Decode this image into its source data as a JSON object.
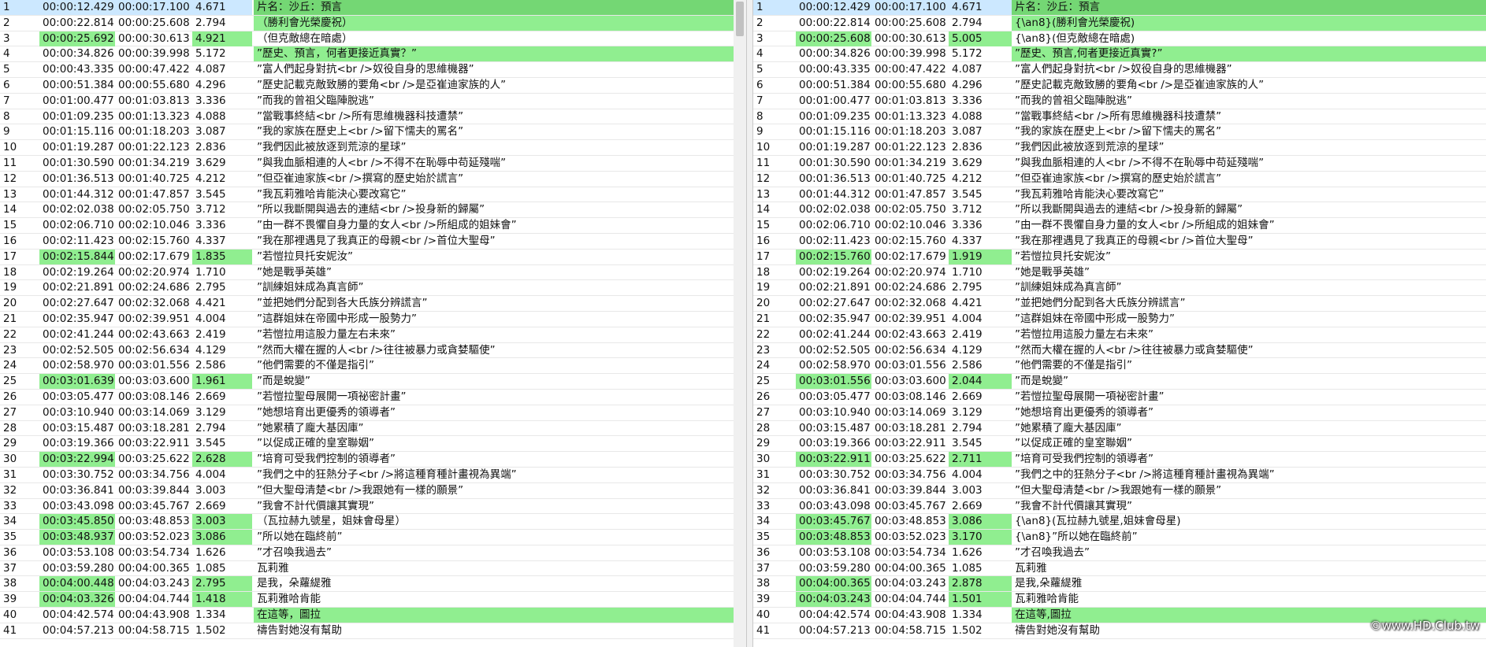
{
  "left": {
    "rows": [
      {
        "n": "1",
        "s": "00:00:12.429",
        "e": "00:00:17.100",
        "d": "4.671",
        "t": "片名：沙丘：預言"
      },
      {
        "n": "2",
        "s": "00:00:22.814",
        "e": "00:00:25.608",
        "d": "2.794",
        "t": "（勝利會光榮慶祝）"
      },
      {
        "n": "3",
        "s": "00:00:25.692",
        "e": "00:00:30.613",
        "d": "4.921",
        "t": "（但克敵總在暗處）"
      },
      {
        "n": "4",
        "s": "00:00:34.826",
        "e": "00:00:39.998",
        "d": "5.172",
        "t": "”歷史、預言，何者更接近真實？”"
      },
      {
        "n": "5",
        "s": "00:00:43.335",
        "e": "00:00:47.422",
        "d": "4.087",
        "t": "”富人們起身對抗<br />奴役自身的思維機器”"
      },
      {
        "n": "6",
        "s": "00:00:51.384",
        "e": "00:00:55.680",
        "d": "4.296",
        "t": "”歷史記載克敵致勝的要角<br />是亞崔迪家族的人”"
      },
      {
        "n": "7",
        "s": "00:01:00.477",
        "e": "00:01:03.813",
        "d": "3.336",
        "t": "”而我的曾祖父臨陣脫逃”"
      },
      {
        "n": "8",
        "s": "00:01:09.235",
        "e": "00:01:13.323",
        "d": "4.088",
        "t": "”當戰事終結<br />所有思維機器科技遭禁”"
      },
      {
        "n": "9",
        "s": "00:01:15.116",
        "e": "00:01:18.203",
        "d": "3.087",
        "t": "”我的家族在歷史上<br />留下懦夫的罵名”"
      },
      {
        "n": "10",
        "s": "00:01:19.287",
        "e": "00:01:22.123",
        "d": "2.836",
        "t": "”我們因此被放逐到荒涼的星球”"
      },
      {
        "n": "11",
        "s": "00:01:30.590",
        "e": "00:01:34.219",
        "d": "3.629",
        "t": "”與我血脈相連的人<br />不得不在恥辱中苟延殘喘”"
      },
      {
        "n": "12",
        "s": "00:01:36.513",
        "e": "00:01:40.725",
        "d": "4.212",
        "t": "”但亞崔迪家族<br />撰寫的歷史始於謊言”"
      },
      {
        "n": "13",
        "s": "00:01:44.312",
        "e": "00:01:47.857",
        "d": "3.545",
        "t": "”我瓦莉雅哈肯能決心要改寫它”"
      },
      {
        "n": "14",
        "s": "00:02:02.038",
        "e": "00:02:05.750",
        "d": "3.712",
        "t": "”所以我斷開與過去的連結<br />投身新的歸屬”"
      },
      {
        "n": "15",
        "s": "00:02:06.710",
        "e": "00:02:10.046",
        "d": "3.336",
        "t": "”由一群不畏懼自身力量的女人<br />所組成的姐妹會”"
      },
      {
        "n": "16",
        "s": "00:02:11.423",
        "e": "00:02:15.760",
        "d": "4.337",
        "t": "”我在那裡遇見了我真正的母親<br />首位大聖母”"
      },
      {
        "n": "17",
        "s": "00:02:15.844",
        "e": "00:02:17.679",
        "d": "1.835",
        "t": "”若愷拉貝托安妮汝”"
      },
      {
        "n": "18",
        "s": "00:02:19.264",
        "e": "00:02:20.974",
        "d": "1.710",
        "t": "”她是戰爭英雄”"
      },
      {
        "n": "19",
        "s": "00:02:21.891",
        "e": "00:02:24.686",
        "d": "2.795",
        "t": "”訓練姐妹成為真言師”"
      },
      {
        "n": "20",
        "s": "00:02:27.647",
        "e": "00:02:32.068",
        "d": "4.421",
        "t": "”並把她們分配到各大氏族分辨謊言”"
      },
      {
        "n": "21",
        "s": "00:02:35.947",
        "e": "00:02:39.951",
        "d": "4.004",
        "t": "”這群姐妹在帝國中形成一股勢力”"
      },
      {
        "n": "22",
        "s": "00:02:41.244",
        "e": "00:02:43.663",
        "d": "2.419",
        "t": "”若愷拉用這股力量左右未來”"
      },
      {
        "n": "23",
        "s": "00:02:52.505",
        "e": "00:02:56.634",
        "d": "4.129",
        "t": "”然而大權在握的人<br />往往被暴力或貪婪驅使”"
      },
      {
        "n": "24",
        "s": "00:02:58.970",
        "e": "00:03:01.556",
        "d": "2.586",
        "t": "”他們需要的不僅是指引”"
      },
      {
        "n": "25",
        "s": "00:03:01.639",
        "e": "00:03:03.600",
        "d": "1.961",
        "t": "”而是蛻變”"
      },
      {
        "n": "26",
        "s": "00:03:05.477",
        "e": "00:03:08.146",
        "d": "2.669",
        "t": "”若愷拉聖母展開一項祕密計畫”"
      },
      {
        "n": "27",
        "s": "00:03:10.940",
        "e": "00:03:14.069",
        "d": "3.129",
        "t": "”她想培育出更優秀的領導者”"
      },
      {
        "n": "28",
        "s": "00:03:15.487",
        "e": "00:03:18.281",
        "d": "2.794",
        "t": "”她累積了龐大基因庫”"
      },
      {
        "n": "29",
        "s": "00:03:19.366",
        "e": "00:03:22.911",
        "d": "3.545",
        "t": "”以促成正確的皇室聯姻”"
      },
      {
        "n": "30",
        "s": "00:03:22.994",
        "e": "00:03:25.622",
        "d": "2.628",
        "t": "”培育可受我們控制的領導者”"
      },
      {
        "n": "31",
        "s": "00:03:30.752",
        "e": "00:03:34.756",
        "d": "4.004",
        "t": "”我們之中的狂熱分子<br />將這種育種計畫視為異端”"
      },
      {
        "n": "32",
        "s": "00:03:36.841",
        "e": "00:03:39.844",
        "d": "3.003",
        "t": "”但大聖母清楚<br />我跟她有一樣的願景”"
      },
      {
        "n": "33",
        "s": "00:03:43.098",
        "e": "00:03:45.767",
        "d": "2.669",
        "t": "”我會不計代價讓其實現”"
      },
      {
        "n": "34",
        "s": "00:03:45.850",
        "e": "00:03:48.853",
        "d": "3.003",
        "t": "（瓦拉赫九號星，姐妹會母星）"
      },
      {
        "n": "35",
        "s": "00:03:48.937",
        "e": "00:03:52.023",
        "d": "3.086",
        "t": "”所以她在臨終前”"
      },
      {
        "n": "36",
        "s": "00:03:53.108",
        "e": "00:03:54.734",
        "d": "1.626",
        "t": "”才召喚我過去”"
      },
      {
        "n": "37",
        "s": "00:03:59.280",
        "e": "00:04:00.365",
        "d": "1.085",
        "t": "瓦莉雅"
      },
      {
        "n": "38",
        "s": "00:04:00.448",
        "e": "00:04:03.243",
        "d": "2.795",
        "t": "是我，朵蘿緹雅"
      },
      {
        "n": "39",
        "s": "00:04:03.326",
        "e": "00:04:04.744",
        "d": "1.418",
        "t": "瓦莉雅哈肯能"
      },
      {
        "n": "40",
        "s": "00:04:42.574",
        "e": "00:04:43.908",
        "d": "1.334",
        "t": "在這等，圖拉"
      },
      {
        "n": "41",
        "s": "00:04:57.213",
        "e": "00:04:58.715",
        "d": "1.502",
        "t": "禱告對她沒有幫助"
      }
    ]
  },
  "right": {
    "rows": [
      {
        "n": "1",
        "s": "00:00:12.429",
        "e": "00:00:17.100",
        "d": "4.671",
        "t": "片名：沙丘：預言"
      },
      {
        "n": "2",
        "s": "00:00:22.814",
        "e": "00:00:25.608",
        "d": "2.794",
        "t": "{\\an8}(勝利會光榮慶祝)"
      },
      {
        "n": "3",
        "s": "00:00:25.608",
        "e": "00:00:30.613",
        "d": "5.005",
        "t": "{\\an8}(但克敵總在暗處)"
      },
      {
        "n": "4",
        "s": "00:00:34.826",
        "e": "00:00:39.998",
        "d": "5.172",
        "t": "”歷史、預言,何者更接近真實?”"
      },
      {
        "n": "5",
        "s": "00:00:43.335",
        "e": "00:00:47.422",
        "d": "4.087",
        "t": "”富人們起身對抗<br />奴役自身的思維機器”"
      },
      {
        "n": "6",
        "s": "00:00:51.384",
        "e": "00:00:55.680",
        "d": "4.296",
        "t": "”歷史記載克敵致勝的要角<br />是亞崔迪家族的人”"
      },
      {
        "n": "7",
        "s": "00:01:00.477",
        "e": "00:01:03.813",
        "d": "3.336",
        "t": "”而我的曾祖父臨陣脫逃”"
      },
      {
        "n": "8",
        "s": "00:01:09.235",
        "e": "00:01:13.323",
        "d": "4.088",
        "t": "”當戰事終結<br />所有思維機器科技遭禁”"
      },
      {
        "n": "9",
        "s": "00:01:15.116",
        "e": "00:01:18.203",
        "d": "3.087",
        "t": "”我的家族在歷史上<br />留下懦夫的罵名”"
      },
      {
        "n": "10",
        "s": "00:01:19.287",
        "e": "00:01:22.123",
        "d": "2.836",
        "t": "”我們因此被放逐到荒涼的星球”"
      },
      {
        "n": "11",
        "s": "00:01:30.590",
        "e": "00:01:34.219",
        "d": "3.629",
        "t": "”與我血脈相連的人<br />不得不在恥辱中苟延殘喘”"
      },
      {
        "n": "12",
        "s": "00:01:36.513",
        "e": "00:01:40.725",
        "d": "4.212",
        "t": "”但亞崔迪家族<br />撰寫的歷史始於謊言”"
      },
      {
        "n": "13",
        "s": "00:01:44.312",
        "e": "00:01:47.857",
        "d": "3.545",
        "t": "”我瓦莉雅哈肯能決心要改寫它”"
      },
      {
        "n": "14",
        "s": "00:02:02.038",
        "e": "00:02:05.750",
        "d": "3.712",
        "t": "”所以我斷開與過去的連結<br />投身新的歸屬”"
      },
      {
        "n": "15",
        "s": "00:02:06.710",
        "e": "00:02:10.046",
        "d": "3.336",
        "t": "”由一群不畏懼自身力量的女人<br />所組成的姐妹會”"
      },
      {
        "n": "16",
        "s": "00:02:11.423",
        "e": "00:02:15.760",
        "d": "4.337",
        "t": "”我在那裡遇見了我真正的母親<br />首位大聖母”"
      },
      {
        "n": "17",
        "s": "00:02:15.760",
        "e": "00:02:17.679",
        "d": "1.919",
        "t": "”若愷拉貝托安妮汝”"
      },
      {
        "n": "18",
        "s": "00:02:19.264",
        "e": "00:02:20.974",
        "d": "1.710",
        "t": "”她是戰爭英雄”"
      },
      {
        "n": "19",
        "s": "00:02:21.891",
        "e": "00:02:24.686",
        "d": "2.795",
        "t": "”訓練姐妹成為真言師”"
      },
      {
        "n": "20",
        "s": "00:02:27.647",
        "e": "00:02:32.068",
        "d": "4.421",
        "t": "”並把她們分配到各大氏族分辨謊言”"
      },
      {
        "n": "21",
        "s": "00:02:35.947",
        "e": "00:02:39.951",
        "d": "4.004",
        "t": "”這群姐妹在帝國中形成一股勢力”"
      },
      {
        "n": "22",
        "s": "00:02:41.244",
        "e": "00:02:43.663",
        "d": "2.419",
        "t": "”若愷拉用這股力量左右未來”"
      },
      {
        "n": "23",
        "s": "00:02:52.505",
        "e": "00:02:56.634",
        "d": "4.129",
        "t": "”然而大權在握的人<br />往往被暴力或貪婪驅使”"
      },
      {
        "n": "24",
        "s": "00:02:58.970",
        "e": "00:03:01.556",
        "d": "2.586",
        "t": "”他們需要的不僅是指引”"
      },
      {
        "n": "25",
        "s": "00:03:01.556",
        "e": "00:03:03.600",
        "d": "2.044",
        "t": "”而是蛻變”"
      },
      {
        "n": "26",
        "s": "00:03:05.477",
        "e": "00:03:08.146",
        "d": "2.669",
        "t": "”若愷拉聖母展開一項祕密計畫”"
      },
      {
        "n": "27",
        "s": "00:03:10.940",
        "e": "00:03:14.069",
        "d": "3.129",
        "t": "”她想培育出更優秀的領導者”"
      },
      {
        "n": "28",
        "s": "00:03:15.487",
        "e": "00:03:18.281",
        "d": "2.794",
        "t": "”她累積了龐大基因庫”"
      },
      {
        "n": "29",
        "s": "00:03:19.366",
        "e": "00:03:22.911",
        "d": "3.545",
        "t": "”以促成正確的皇室聯姻”"
      },
      {
        "n": "30",
        "s": "00:03:22.911",
        "e": "00:03:25.622",
        "d": "2.711",
        "t": "”培育可受我們控制的領導者”"
      },
      {
        "n": "31",
        "s": "00:03:30.752",
        "e": "00:03:34.756",
        "d": "4.004",
        "t": "”我們之中的狂熱分子<br />將這種育種計畫視為異端”"
      },
      {
        "n": "32",
        "s": "00:03:36.841",
        "e": "00:03:39.844",
        "d": "3.003",
        "t": "”但大聖母清楚<br />我跟她有一樣的願景”"
      },
      {
        "n": "33",
        "s": "00:03:43.098",
        "e": "00:03:45.767",
        "d": "2.669",
        "t": "”我會不計代價讓其實現”"
      },
      {
        "n": "34",
        "s": "00:03:45.767",
        "e": "00:03:48.853",
        "d": "3.086",
        "t": "{\\an8}(瓦拉赫九號星,姐妹會母星)"
      },
      {
        "n": "35",
        "s": "00:03:48.853",
        "e": "00:03:52.023",
        "d": "3.170",
        "t": "{\\an8}”所以她在臨終前”"
      },
      {
        "n": "36",
        "s": "00:03:53.108",
        "e": "00:03:54.734",
        "d": "1.626",
        "t": "”才召喚我過去”"
      },
      {
        "n": "37",
        "s": "00:03:59.280",
        "e": "00:04:00.365",
        "d": "1.085",
        "t": "瓦莉雅"
      },
      {
        "n": "38",
        "s": "00:04:00.365",
        "e": "00:04:03.243",
        "d": "2.878",
        "t": "是我,朵蘿緹雅"
      },
      {
        "n": "39",
        "s": "00:04:03.243",
        "e": "00:04:04.744",
        "d": "1.501",
        "t": "瓦莉雅哈肯能"
      },
      {
        "n": "40",
        "s": "00:04:42.574",
        "e": "00:04:43.908",
        "d": "1.334",
        "t": "在這等,圖拉"
      },
      {
        "n": "41",
        "s": "00:04:57.213",
        "e": "00:04:58.715",
        "d": "1.502",
        "t": "禱告對她沒有幫助"
      }
    ]
  },
  "highlight": {
    "left_time_rows": [
      "3",
      "17",
      "25",
      "30",
      "34",
      "35",
      "38",
      "39"
    ],
    "right_time_rows": [
      "3",
      "17",
      "25",
      "30",
      "34",
      "35",
      "38",
      "39"
    ],
    "text_rows": [
      "2",
      "4",
      "40"
    ],
    "colors": {
      "diff": "#90ee90",
      "selected": "#cce8ff",
      "first_text": "#74d774"
    }
  },
  "watermark": "©www.HD.Club.tw"
}
